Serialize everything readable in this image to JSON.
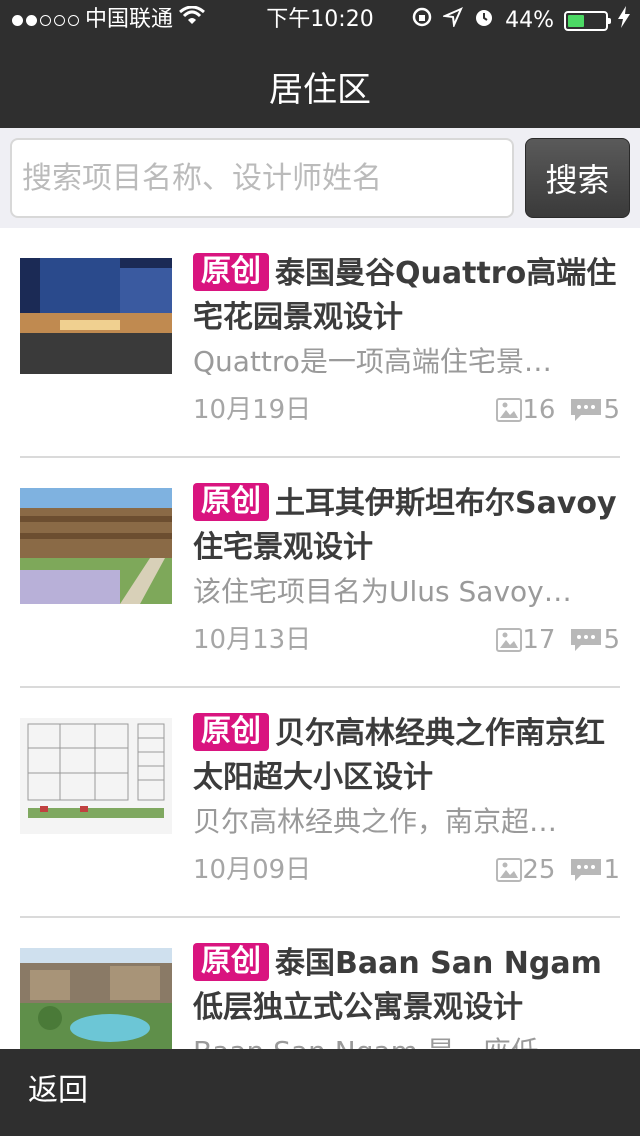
{
  "status": {
    "carrier": "中国联通",
    "time": "下午10:20",
    "battery": "44%",
    "battery_level": 0.44,
    "signal_bars_filled": 2,
    "signal_bars_total": 5
  },
  "nav": {
    "title": "居住区"
  },
  "search": {
    "placeholder": "搜索项目名称、设计师姓名",
    "button": "搜索"
  },
  "items": [
    {
      "badge": "原创",
      "title": "泰国曼谷Quattro高端住宅花园景观设计",
      "desc": "Quattro是一项高端住宅景…",
      "date": "10月19日",
      "images": "16",
      "comments": "5"
    },
    {
      "badge": "原创",
      "title": "土耳其伊斯坦布尔Savoy住宅景观设计",
      "desc": "该住宅项目名为Ulus Savoy…",
      "date": "10月13日",
      "images": "17",
      "comments": "5"
    },
    {
      "badge": "原创",
      "title": "贝尔高林经典之作南京红太阳超大小区设计",
      "desc": "贝尔高林经典之作，南京超…",
      "date": "10月09日",
      "images": "25",
      "comments": "1"
    },
    {
      "badge": "原创",
      "title": "泰国Baan San Ngam低层独立式公寓景观设计",
      "desc": "Baan San Ngam 是一座低…",
      "date": "",
      "images": "",
      "comments": ""
    }
  ],
  "bottom": {
    "back": "返回"
  },
  "colors": {
    "bar": "#2f2f2f",
    "badge": "#d9147f",
    "battery": "#4cd964"
  }
}
